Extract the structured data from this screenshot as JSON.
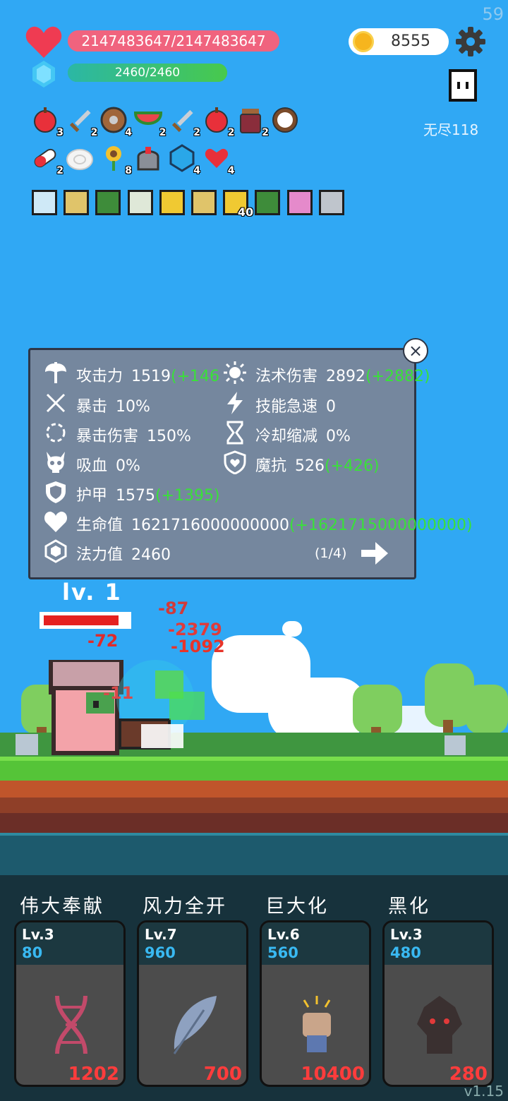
{
  "fps": "59",
  "player": {
    "hp_text": "2147483647/2147483647",
    "hp_fraction": 1.0,
    "mp_text": "2460/2460",
    "mp_fraction": 1.0
  },
  "coins": "8555",
  "mode_label": "无尽118",
  "items_row1": [
    {
      "icon": "apple-icon",
      "count": "3"
    },
    {
      "icon": "sword-icon",
      "count": "2"
    },
    {
      "icon": "shield-icon",
      "count": "4"
    },
    {
      "icon": "watermelon-icon",
      "count": "2"
    },
    {
      "icon": "sword-icon",
      "count": "2"
    },
    {
      "icon": "strawberry-icon",
      "count": "2"
    },
    {
      "icon": "jam-jar-icon",
      "count": "2"
    },
    {
      "icon": "coconut-icon",
      "count": ""
    }
  ],
  "items_row2": [
    {
      "icon": "pill-icon",
      "count": "2"
    },
    {
      "icon": "bun-icon",
      "count": ""
    },
    {
      "icon": "sunflower-icon",
      "count": "8"
    },
    {
      "icon": "helmet-icon",
      "count": ""
    },
    {
      "icon": "blue-gem-icon",
      "count": "4"
    },
    {
      "icon": "hearts-icon",
      "count": "4"
    }
  ],
  "tiles": [
    {
      "icon": "light-rune-icon",
      "count": ""
    },
    {
      "icon": "shield-rune-icon",
      "count": ""
    },
    {
      "icon": "green-rune-icon",
      "count": ""
    },
    {
      "icon": "sprout-rune-icon",
      "count": ""
    },
    {
      "icon": "skull-rune-icon",
      "count": ""
    },
    {
      "icon": "shield-rune-icon",
      "count": ""
    },
    {
      "icon": "skull-rune-icon",
      "count": "40"
    },
    {
      "icon": "green-rune-icon",
      "count": ""
    },
    {
      "icon": "face-rune-icon",
      "count": ""
    },
    {
      "icon": "armor-rune-icon",
      "count": ""
    }
  ],
  "stats": {
    "attack": {
      "label": "攻击力",
      "value": "1519",
      "bonus": "(+146"
    },
    "spell_damage": {
      "label": "法术伤害",
      "value": "2892",
      "bonus": "(+2882)"
    },
    "crit": {
      "label": "暴击",
      "value": "10%"
    },
    "skill_haste": {
      "label": "技能急速",
      "value": "0"
    },
    "crit_damage": {
      "label": "暴击伤害",
      "value": "150%"
    },
    "cooldown": {
      "label": "冷却缩减",
      "value": "0%"
    },
    "lifesteal": {
      "label": "吸血",
      "value": "0%"
    },
    "magic_resist": {
      "label": "魔抗",
      "value": "526",
      "bonus": "(+426)"
    },
    "armor": {
      "label": "护甲",
      "value": "1575",
      "bonus": "(+1395)"
    },
    "health": {
      "label": "生命值",
      "value": "1621716000000000",
      "bonus": "(+1621715000000000)"
    },
    "mana": {
      "label": "法力值",
      "value": "2460"
    },
    "page": "(1/4)",
    "close": "×"
  },
  "enemy": {
    "level": "lv. 1",
    "hp_fraction": 0.9
  },
  "damage_numbers": {
    "d1": "-87",
    "d2": "-2379",
    "d3": "-11",
    "d4": "-72",
    "d5": "-1092"
  },
  "skills": [
    {
      "name": "伟大奉献",
      "level": "Lv.3",
      "cost": "80",
      "price": "1202",
      "icon": "dna-icon"
    },
    {
      "name": "风力全开",
      "level": "Lv.7",
      "cost": "960",
      "price": "700",
      "icon": "feather-icon"
    },
    {
      "name": "巨大化",
      "level": "Lv.6",
      "cost": "560",
      "price": "10400",
      "icon": "fist-icon"
    },
    {
      "name": "黑化",
      "level": "Lv.3",
      "cost": "480",
      "price": "280",
      "icon": "dark-tree-icon"
    }
  ],
  "version": "v1.15",
  "colors": {
    "sky": "#30a8f4",
    "hp": "#f0637e",
    "mp": "#48c94c",
    "bonus": "#39e139",
    "price": "#ff3c3c",
    "cost": "#39b9f2"
  }
}
